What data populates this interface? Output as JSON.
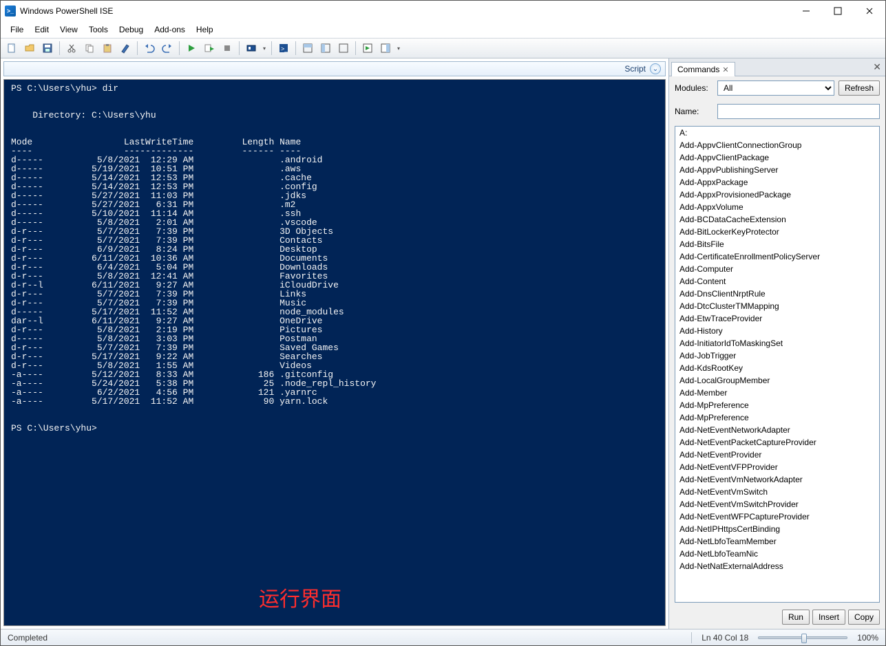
{
  "window": {
    "title": "Windows PowerShell ISE"
  },
  "menus": [
    "File",
    "Edit",
    "View",
    "Tools",
    "Debug",
    "Add-ons",
    "Help"
  ],
  "script_label": "Script",
  "console": {
    "prompt1": "PS C:\\Users\\yhu> dir",
    "dir_header": "    Directory: C:\\Users\\yhu",
    "col_header": "Mode                 LastWriteTime         Length Name",
    "col_rule": "----                 -------------         ------ ----",
    "rows": [
      "d-----          5/8/2021  12:29 AM                .android",
      "d-----         5/19/2021  10:51 PM                .aws",
      "d-----         5/14/2021  12:53 PM                .cache",
      "d-----         5/14/2021  12:53 PM                .config",
      "d-----         5/27/2021  11:03 PM                .jdks",
      "d-----         5/27/2021   6:31 PM                .m2",
      "d-----         5/10/2021  11:14 AM                .ssh",
      "d-----          5/8/2021   2:01 AM                .vscode",
      "d-r---          5/7/2021   7:39 PM                3D Objects",
      "d-r---          5/7/2021   7:39 PM                Contacts",
      "d-r---          6/9/2021   8:24 PM                Desktop",
      "d-r---         6/11/2021  10:36 AM                Documents",
      "d-r---          6/4/2021   5:04 PM                Downloads",
      "d-r---          5/8/2021  12:41 AM                Favorites",
      "d-r--l         6/11/2021   9:27 AM                iCloudDrive",
      "d-r---          5/7/2021   7:39 PM                Links",
      "d-r---          5/7/2021   7:39 PM                Music",
      "d-----         5/17/2021  11:52 AM                node_modules",
      "dar--l         6/11/2021   9:27 AM                OneDrive",
      "d-r---          5/8/2021   2:19 PM                Pictures",
      "d-----          5/8/2021   3:03 PM                Postman",
      "d-r---          5/7/2021   7:39 PM                Saved Games",
      "d-r---         5/17/2021   9:22 AM                Searches",
      "d-r---          5/8/2021   1:55 AM                Videos",
      "-a----         5/12/2021   8:33 AM            186 .gitconfig",
      "-a----         5/24/2021   5:38 PM             25 .node_repl_history",
      "-a----          6/2/2021   4:56 PM            121 .yarnrc",
      "-a----         5/17/2021  11:52 AM             90 yarn.lock"
    ],
    "prompt2": "PS C:\\Users\\yhu> ",
    "annotation": "运行界面"
  },
  "commands_panel": {
    "tab": "Commands",
    "modules_label": "Modules:",
    "modules_value": "All",
    "name_label": "Name:",
    "refresh": "Refresh",
    "run": "Run",
    "insert": "Insert",
    "copy": "Copy",
    "items": [
      "A:",
      "Add-AppvClientConnectionGroup",
      "Add-AppvClientPackage",
      "Add-AppvPublishingServer",
      "Add-AppxPackage",
      "Add-AppxProvisionedPackage",
      "Add-AppxVolume",
      "Add-BCDataCacheExtension",
      "Add-BitLockerKeyProtector",
      "Add-BitsFile",
      "Add-CertificateEnrollmentPolicyServer",
      "Add-Computer",
      "Add-Content",
      "Add-DnsClientNrptRule",
      "Add-DtcClusterTMMapping",
      "Add-EtwTraceProvider",
      "Add-History",
      "Add-InitiatorIdToMaskingSet",
      "Add-JobTrigger",
      "Add-KdsRootKey",
      "Add-LocalGroupMember",
      "Add-Member",
      "Add-MpPreference",
      "Add-MpPreference",
      "Add-NetEventNetworkAdapter",
      "Add-NetEventPacketCaptureProvider",
      "Add-NetEventProvider",
      "Add-NetEventVFPProvider",
      "Add-NetEventVmNetworkAdapter",
      "Add-NetEventVmSwitch",
      "Add-NetEventVmSwitchProvider",
      "Add-NetEventWFPCaptureProvider",
      "Add-NetIPHttpsCertBinding",
      "Add-NetLbfoTeamMember",
      "Add-NetLbfoTeamNic",
      "Add-NetNatExternalAddress"
    ]
  },
  "status": {
    "text": "Completed",
    "pos": "Ln 40  Col 18",
    "zoom": "100%"
  }
}
